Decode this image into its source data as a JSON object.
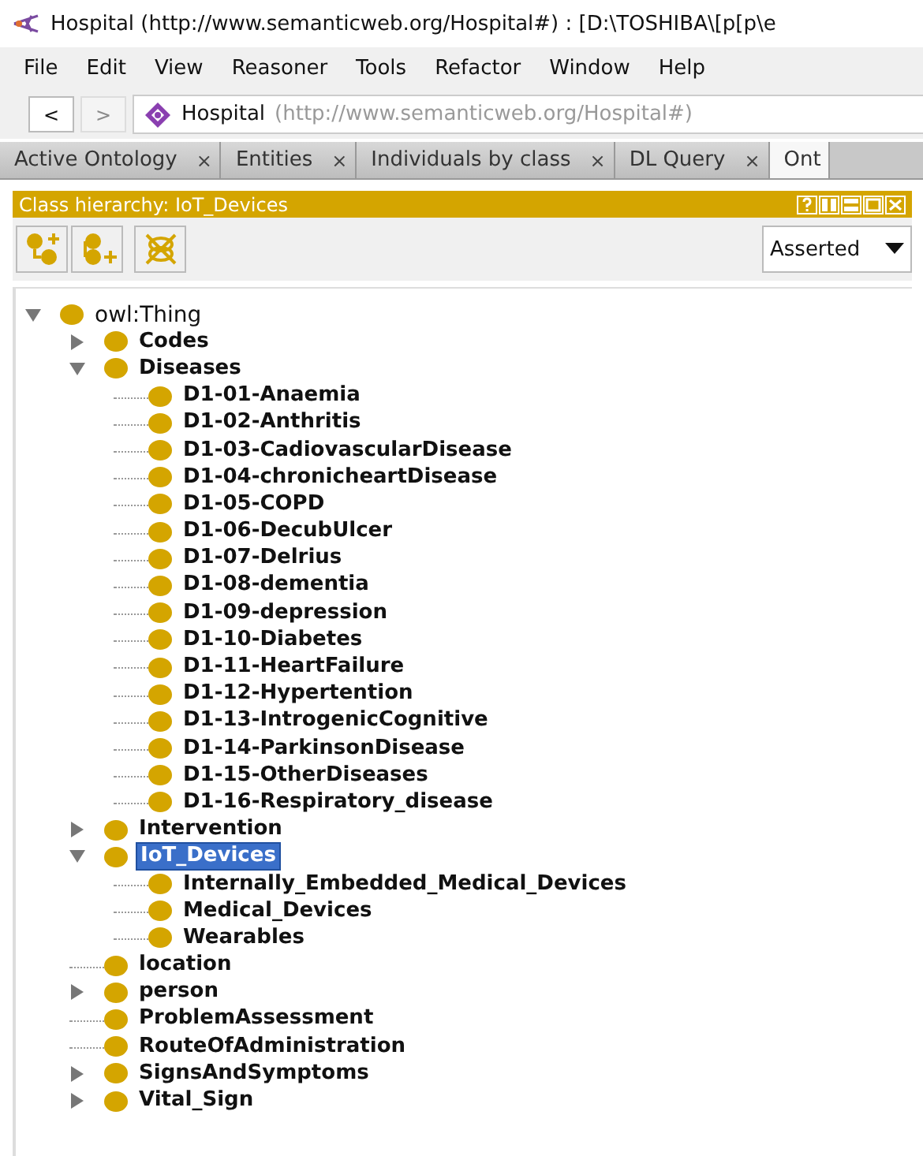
{
  "window": {
    "title": "Hospital (http://www.semanticweb.org/Hospital#)  : [D:\\TOSHIBA\\[p[p\\e"
  },
  "menu": [
    "File",
    "Edit",
    "View",
    "Reasoner",
    "Tools",
    "Refactor",
    "Window",
    "Help"
  ],
  "nav": {
    "back": {
      "label": "<",
      "disabled": false
    },
    "forward": {
      "label": ">",
      "disabled": true
    },
    "ontology": "Hospital",
    "iri": "(http://www.semanticweb.org/Hospital#)"
  },
  "tabs": [
    {
      "label": "Active Ontology",
      "close": "×",
      "selected": false
    },
    {
      "label": "Entities",
      "close": "×",
      "selected": false
    },
    {
      "label": "Individuals by class",
      "close": "×",
      "selected": false
    },
    {
      "label": "DL Query",
      "close": "×",
      "selected": false
    },
    {
      "label": "Ont",
      "selected": true
    }
  ],
  "view": {
    "title": "Class hierarchy: IoT_Devices",
    "mode": "Asserted"
  },
  "tree": [
    {
      "label": "owl:Thing",
      "expanded": true,
      "selected": false,
      "children": [
        {
          "label": "Codes",
          "expanded": false,
          "selected": false
        },
        {
          "label": "Diseases",
          "expanded": true,
          "selected": false,
          "children": [
            {
              "label": "D1-01-Anaemia",
              "selected": false
            },
            {
              "label": "D1-02-Anthritis",
              "selected": false
            },
            {
              "label": "D1-03-CadiovascularDisease",
              "selected": false
            },
            {
              "label": "D1-04-chronicheartDisease",
              "selected": false
            },
            {
              "label": "D1-05-COPD",
              "selected": false
            },
            {
              "label": "D1-06-DecubUlcer",
              "selected": false
            },
            {
              "label": "D1-07-Delrius",
              "selected": false
            },
            {
              "label": "D1-08-dementia",
              "selected": false
            },
            {
              "label": "D1-09-depression",
              "selected": false
            },
            {
              "label": "D1-10-Diabetes",
              "selected": false
            },
            {
              "label": "D1-11-HeartFailure",
              "selected": false
            },
            {
              "label": "D1-12-Hypertention",
              "selected": false
            },
            {
              "label": "D1-13-IntrogenicCognitive",
              "selected": false
            },
            {
              "label": "D1-14-ParkinsonDisease",
              "selected": false
            },
            {
              "label": "D1-15-OtherDiseases",
              "selected": false
            },
            {
              "label": "D1-16-Respiratory_disease",
              "selected": false
            }
          ]
        },
        {
          "label": "Intervention",
          "expanded": false,
          "selected": false
        },
        {
          "label": "IoT_Devices",
          "expanded": true,
          "selected": true,
          "children": [
            {
              "label": "Internally_Embedded_Medical_Devices",
              "selected": false
            },
            {
              "label": "Medical_Devices",
              "selected": false
            },
            {
              "label": "Wearables",
              "selected": false
            }
          ]
        },
        {
          "label": "location",
          "selected": false
        },
        {
          "label": "person",
          "expanded": false,
          "selected": false
        },
        {
          "label": "ProblemAssessment",
          "selected": false
        },
        {
          "label": "RouteOfAdministration",
          "selected": false
        },
        {
          "label": "SignsAndSymptoms",
          "expanded": false,
          "selected": false
        },
        {
          "label": "Vital_Sign",
          "expanded": false,
          "selected": false
        }
      ]
    }
  ]
}
